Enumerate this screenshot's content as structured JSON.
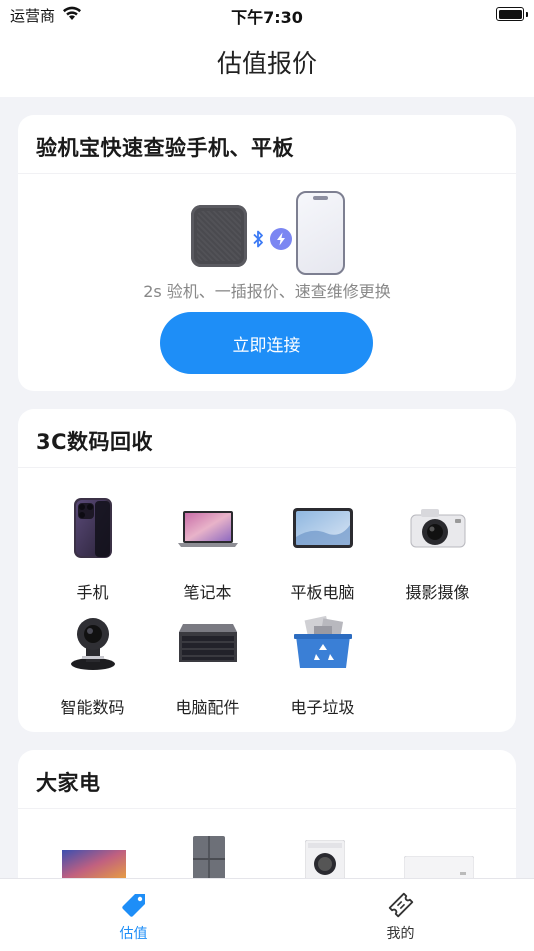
{
  "status_bar": {
    "carrier": "运营商",
    "time": "下午7:30"
  },
  "nav": {
    "title": "估值报价"
  },
  "inspect_card": {
    "title": "验机宝快速查验手机、平板",
    "description": "2s 验机、一插报价、速查维修更换",
    "connect_label": "立即连接"
  },
  "digital_card": {
    "title": "3C数码回收",
    "categories": [
      {
        "label": "手机",
        "icon": "smartphone-icon"
      },
      {
        "label": "笔记本",
        "icon": "laptop-icon"
      },
      {
        "label": "平板电脑",
        "icon": "tablet-icon"
      },
      {
        "label": "摄影摄像",
        "icon": "camera-icon"
      },
      {
        "label": "智能数码",
        "icon": "conference-camera-icon"
      },
      {
        "label": "电脑配件",
        "icon": "server-icon"
      },
      {
        "label": "电子垃圾",
        "icon": "recycle-bin-icon"
      }
    ]
  },
  "appliance_card": {
    "title": "大家电",
    "categories": [
      {
        "icon": "tv-icon"
      },
      {
        "icon": "refrigerator-icon"
      },
      {
        "icon": "washing-machine-icon"
      },
      {
        "icon": "air-conditioner-icon"
      }
    ]
  },
  "tab_bar": {
    "tabs": [
      {
        "label": "估值",
        "icon": "price-tag-icon",
        "active": true
      },
      {
        "label": "我的",
        "icon": "ticket-icon",
        "active": false
      }
    ]
  },
  "colors": {
    "accent": "#1e8ef7",
    "background": "#f2f3f7",
    "card": "#ffffff"
  }
}
